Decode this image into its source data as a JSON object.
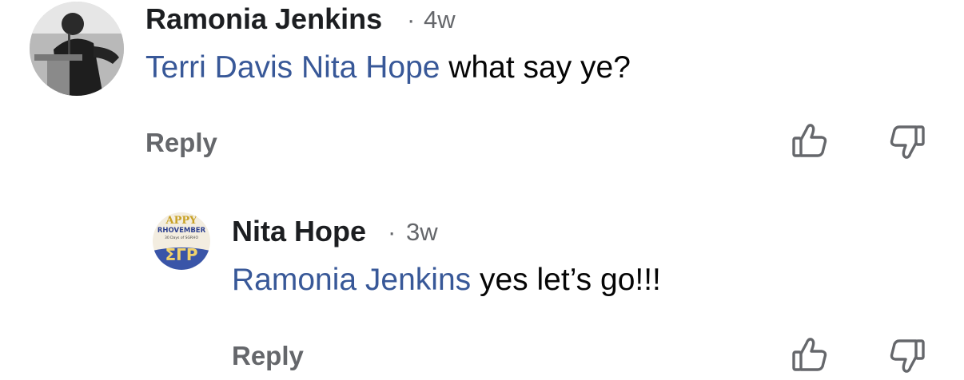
{
  "comments": [
    {
      "author": "Ramonia Jenkins",
      "separator": "·",
      "time": "4w",
      "mentions": "Terri Davis Nita Hope",
      "text": " what say ye?",
      "reply_label": "Reply",
      "like_icon": "thumbs-up-icon",
      "dislike_icon": "thumbs-down-icon",
      "avatar": "user-photo"
    },
    {
      "author": "Nita Hope",
      "separator": "·",
      "time": "3w",
      "mentions": "Ramonia Jenkins",
      "text": " yes let’s go!!!",
      "reply_label": "Reply",
      "like_icon": "thumbs-up-icon",
      "dislike_icon": "thumbs-down-icon",
      "avatar": "sorority-logo",
      "avatar_text_top": "APPY",
      "avatar_text_mid": "RHOVEMBER",
      "avatar_text_small": "30 Days of SGRHO",
      "avatar_text_letters": "ΣΓΡ"
    }
  ],
  "colors": {
    "mention": "#385898",
    "meta": "#65676b",
    "text": "#050505"
  }
}
